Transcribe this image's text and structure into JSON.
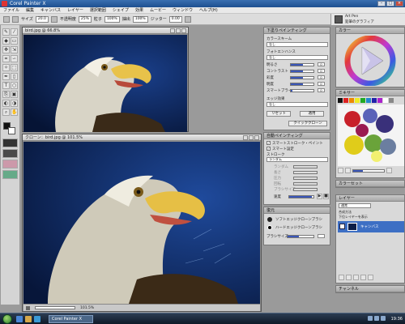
{
  "app": {
    "title": "Corel Painter X"
  },
  "menu": [
    "ファイル",
    "編集",
    "キャンバス",
    "レイヤー",
    "選択範囲",
    "シェイプ",
    "効果",
    "ムービー",
    "ウィンドウ",
    "ヘルプ(H)"
  ],
  "property_bar": {
    "size_label": "サイズ",
    "size": "20.0",
    "opacity_label": "不透明度",
    "opacity": "25%",
    "grain_label": "粒子",
    "grain": "100%",
    "bleed_label": "抽出",
    "bleed": "100%",
    "jitter_label": "ジッター",
    "jitter": "0.00"
  },
  "brush_selector": {
    "category": "Art Pen",
    "variant": "鉛筆のグラフィア"
  },
  "doc_windows": [
    {
      "title": "bird.jpg @ 66.8%"
    },
    {
      "title": "クローン：bird.jpg @ 101.5%",
      "zoom_value": "101.5%"
    }
  ],
  "underpainting": {
    "title": "下塗りペインティング",
    "color_scheme_label": "カラースキーム",
    "color_scheme": "なし",
    "photo_enhance_label": "フォトエンハンス",
    "photo_enhance": "なし",
    "sliders": [
      {
        "label": "明るさ",
        "value": "0"
      },
      {
        "label": "コントラスト",
        "value": "0"
      },
      {
        "label": "彩度",
        "value": "0"
      },
      {
        "label": "明度",
        "value": "0"
      },
      {
        "label": "スマートブラー",
        "value": "0"
      }
    ],
    "edge_effect_label": "エッジ効果",
    "edge_effect": "なし",
    "reset_button": "リセット",
    "apply_button": "適用",
    "quick_clone_button": "クイッククローン"
  },
  "auto_painting": {
    "title": "自動ペインティング",
    "smart_stroke_label": "スマートストローク・ペイント",
    "smart_settings_label": "スマート設定",
    "stroke_label": "ストローク",
    "stroke_value": "ランダム",
    "rows": [
      "ランダム",
      "長さ",
      "圧力",
      "回転",
      "ブラシサイズ"
    ],
    "speed_label": "速度"
  },
  "restoration": {
    "title": "復元",
    "items": [
      "ソフトエッジクローンブラシ",
      "ハードエッジクローンブラシ"
    ],
    "brush_size_label": "ブラシサイズ"
  },
  "color_panel": {
    "title": "カラー"
  },
  "mixer_panel": {
    "title": "ミキサー"
  },
  "color_sets_panel": {
    "title": "カラーセット"
  },
  "layers_panel": {
    "title": "レイヤー",
    "blend_mode": "通常",
    "composite_label": "合成方法",
    "composite_value": "下位レイヤーを表示",
    "layer_name": "キャンバス"
  },
  "channels_panel": {
    "title": "チャンネル"
  },
  "taskbar": {
    "task": "Corel Painter X",
    "clock": "19:36"
  },
  "colors": {
    "accent": "#3a56b8",
    "titlebar": "#2a5fa3",
    "canvas_bg": "#0b1d48",
    "layer_selected": "#3d6fc4"
  }
}
